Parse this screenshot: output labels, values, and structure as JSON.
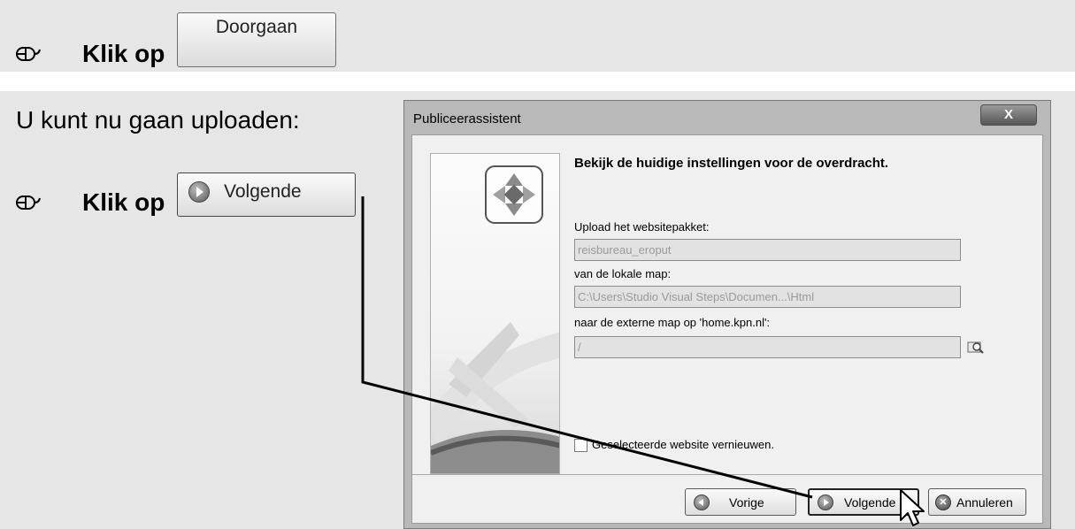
{
  "step1": {
    "instruction": "Klik op",
    "button_label": "Doorgaan"
  },
  "intro": "U kunt nu gaan uploaden:",
  "step2": {
    "instruction": "Klik op",
    "button_label": "Volgende"
  },
  "dialog": {
    "title": "Publiceerassistent",
    "close_label": "X",
    "heading": "Bekijk de huidige instellingen voor de overdracht.",
    "package_label": "Upload het websitepakket:",
    "package_value": "reisbureau_eroput",
    "local_label": "van de lokale map:",
    "local_value": "C:\\Users\\Studio Visual Steps\\Documen...\\Html",
    "remote_label": "naar de externe map op 'home.kpn.nl':",
    "remote_value": "/",
    "checkbox_label": "Geselecteerde website vernieuwen.",
    "checkbox_checked": false,
    "buttons": {
      "back": "Vorige",
      "next": "Volgende",
      "cancel": "Annuleren"
    }
  },
  "icons": {
    "mouse": "mouse-icon",
    "play": "play-icon",
    "back": "back-icon",
    "close": "close-icon",
    "browse": "browse-folder-icon",
    "wizard": "wizard-arrows-icon"
  }
}
